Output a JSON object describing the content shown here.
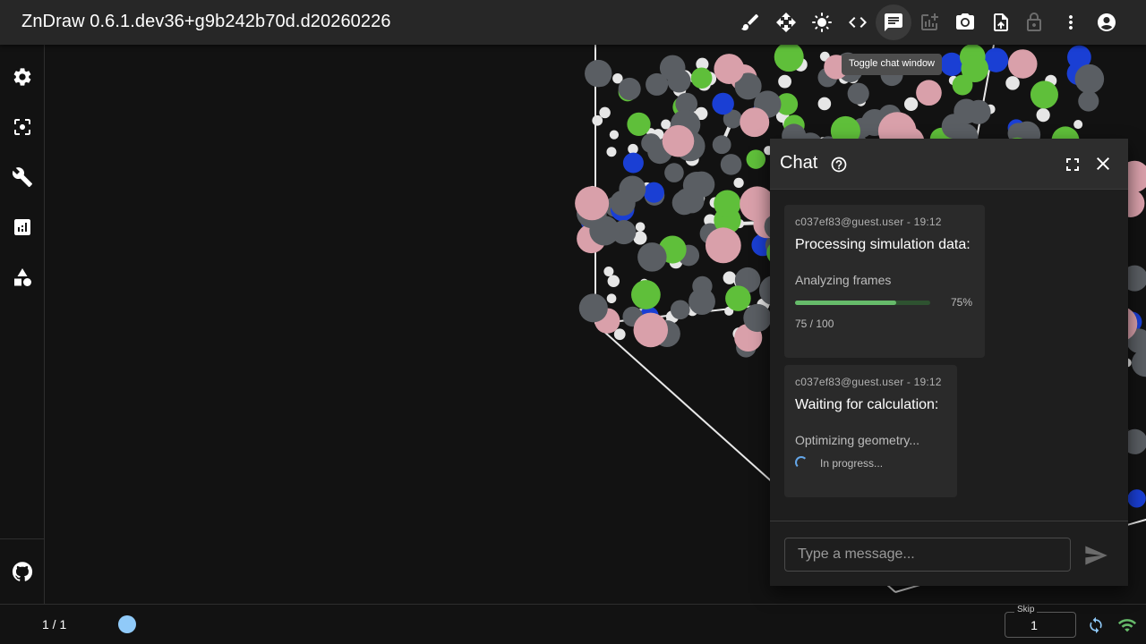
{
  "app": {
    "title": "ZnDraw 0.6.1.dev36+g9b242b70d.d20260226",
    "toolbar_icons": [
      "brush-icon",
      "move-icon",
      "brightness-icon",
      "code-icon",
      "chat-icon",
      "add-chart-icon",
      "camera-icon",
      "upload-file-icon",
      "lock-icon",
      "more-vert-icon",
      "account-icon"
    ],
    "tooltip": "Toggle chat window"
  },
  "sidebar": {
    "icons": [
      "settings-icon",
      "center-focus-icon",
      "build-icon",
      "analytics-icon",
      "shapes-icon"
    ],
    "bottom_icon": "github-icon"
  },
  "chat": {
    "title": "Chat",
    "messages": [
      {
        "meta": "c037ef83@guest.user - 19:12",
        "heading": "Processing simulation data:",
        "task": "Analyzing frames",
        "progress_percent": 75,
        "progress_label": "75%",
        "progress_count": "75 / 100"
      },
      {
        "meta": "c037ef83@guest.user - 19:12",
        "heading": "Waiting for calculation:",
        "task": "Optimizing geometry...",
        "status": "In progress..."
      }
    ],
    "input_placeholder": "Type a message..."
  },
  "bottombar": {
    "frame_count": "1 / 1",
    "skip_label": "Skip",
    "skip_value": "1"
  },
  "colors": {
    "progress": "#66bb6a",
    "frame_dot": "#90caf9",
    "connected": "#66bb6a",
    "carbon": "#5a5e63",
    "nitrogen": "#1a3fd4",
    "hydrogen": "#e6e6e6",
    "chlorine": "#5fbf3a",
    "fluorine": "#d9a0aa"
  }
}
